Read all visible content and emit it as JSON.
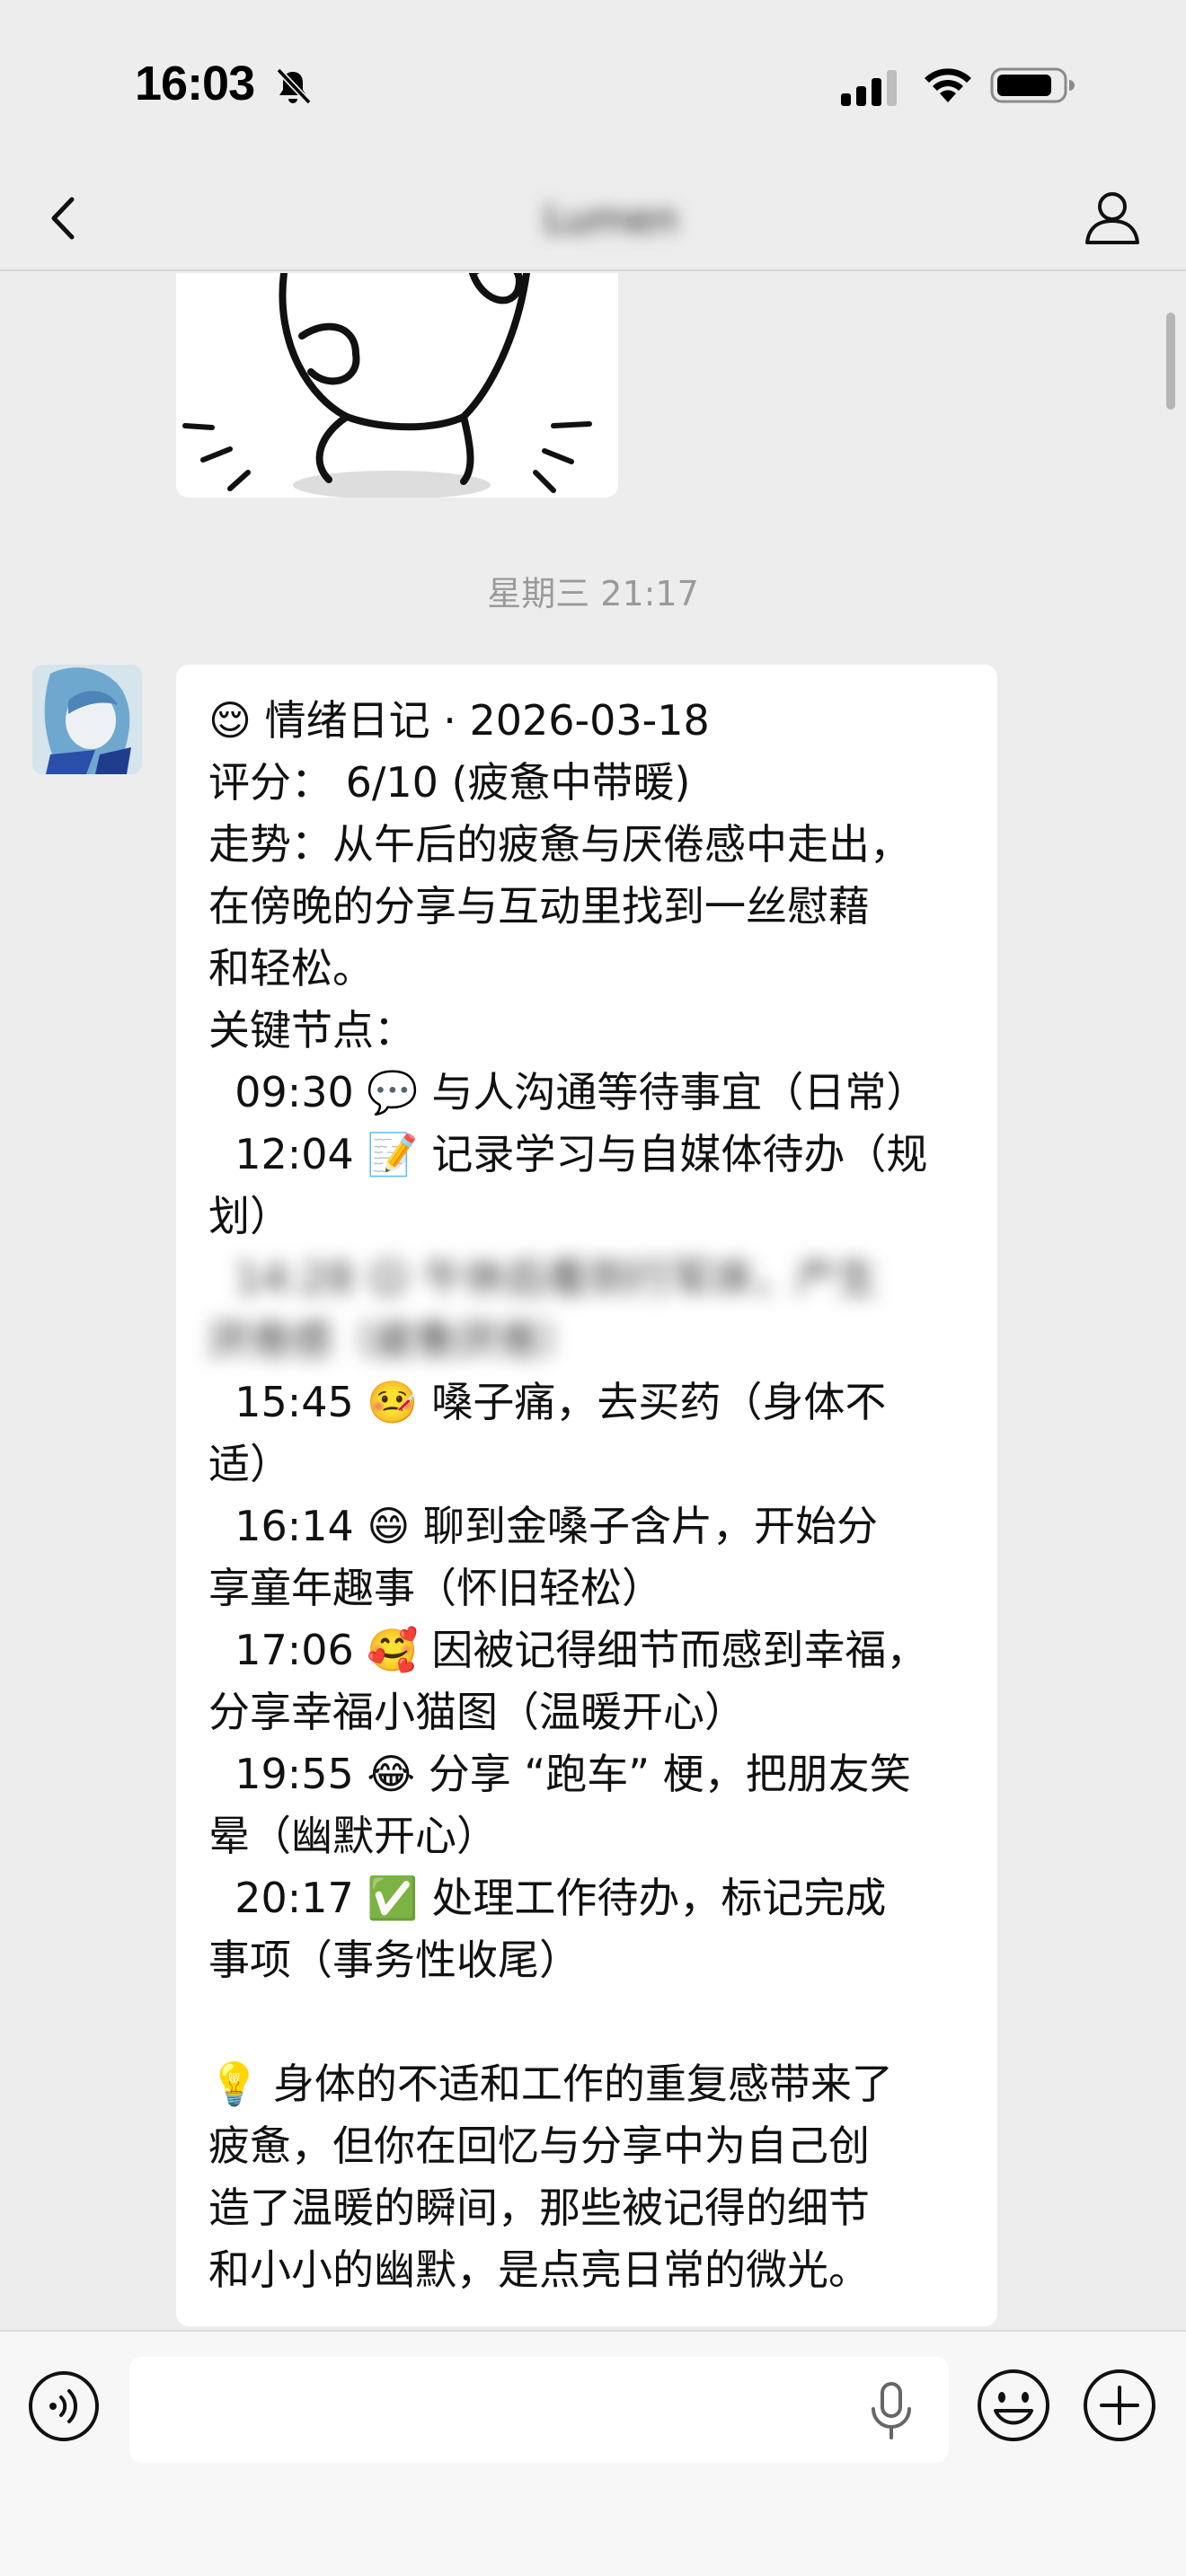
{
  "status_bar": {
    "time": "16:03",
    "icons": [
      "bell-slash-icon",
      "cellular-signal-icon",
      "wifi-icon",
      "battery-icon"
    ]
  },
  "nav": {
    "title": "Lumen",
    "back_icon": "chevron-left-icon",
    "profile_icon": "person-icon"
  },
  "chat": {
    "timestamp": "星期三 21:17",
    "message": {
      "lines": [
        "😌 情绪日记 · 2026-03-18",
        "评分： 6/10 (疲惫中带暖)",
        "走势：从午后的疲惫与厌倦感中走出，",
        "在傍晚的分享与互动里找到一丝慰藉",
        "和轻松。",
        "关键节点：",
        "  09:30 💬 与人沟通等待事宜（日常）",
        "  12:04 📝 记录学习与自媒体待办（规",
        "划）",
        "  14:28 😑 午休后看到行军床，产生",
        "厌倦感（疲惫厌倦）",
        "  15:45 🤒 嗓子痛，去买药（身体不",
        "适）",
        "  16:14 😄 聊到金嗓子含片，开始分",
        "享童年趣事（怀旧轻松）",
        "  17:06 🥰 因被记得细节而感到幸福，",
        "分享幸福小猫图（温暖开心）",
        "  19:55 😂 分享 “跑车” 梗，把朋友笑",
        "晕（幽默开心）",
        "  20:17 ✅ 处理工作待办，标记完成",
        "事项（事务性收尾）",
        "",
        "💡 身体的不适和工作的重复感带来了",
        "疲惫，但你在回忆与分享中为自己创",
        "造了温暖的瞬间，那些被记得的细节",
        "和小小的幽默，是点亮日常的微光。"
      ]
    }
  },
  "input_bar": {
    "value": "",
    "icons": [
      "voice-icon",
      "microphone-icon",
      "emoji-icon",
      "plus-icon"
    ]
  }
}
